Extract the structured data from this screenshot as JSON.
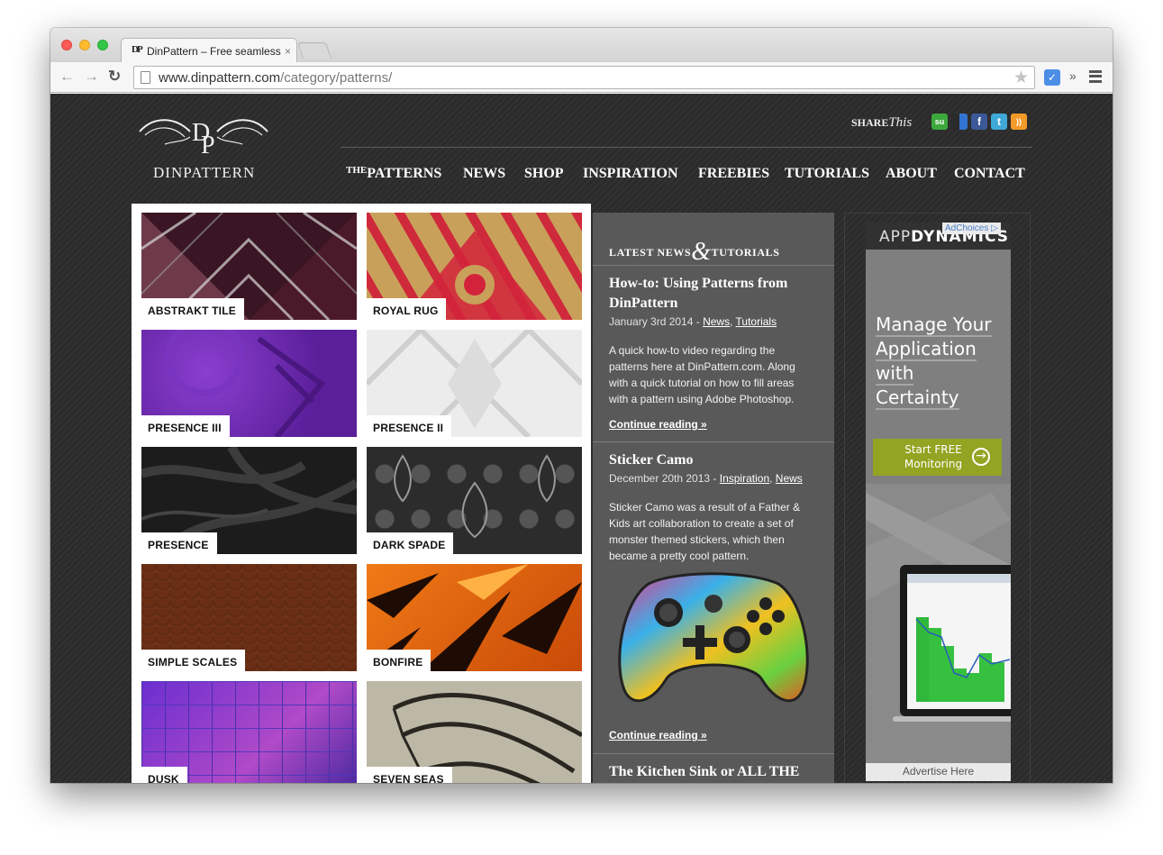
{
  "browser": {
    "tab_title": "DinPattern – Free seamless",
    "tab_favicon": "DP",
    "tab_close": "×",
    "url_domain": "www.dinpattern.com",
    "url_path": "/category/patterns/",
    "back_glyph": "←",
    "forward_glyph": "→",
    "reload_glyph": "↻",
    "star_glyph": "★",
    "ext_glyph": "✓",
    "overflow_glyph": "»"
  },
  "site": {
    "logo_text": "DINPATTERN",
    "logo_mark": "DP",
    "share_prefix": "SHARE",
    "share_script": "This",
    "social": [
      {
        "icon": "stumbleupon-icon",
        "glyph": "su",
        "color": "#3ca83c"
      },
      {
        "icon": "delicious-icon",
        "glyph": "",
        "color": "#ffffff"
      },
      {
        "icon": "facebook-icon",
        "glyph": "f",
        "color": "#3b5998"
      },
      {
        "icon": "twitter-icon",
        "glyph": "t",
        "color": "#3fa9d8"
      },
      {
        "icon": "rss-icon",
        "glyph": "))",
        "color": "#f39a29"
      }
    ],
    "nav": {
      "patterns_prefix": "THE",
      "patterns": "PATTERNS",
      "news": "NEWS",
      "shop": "SHOP",
      "inspiration": "INSPIRATION",
      "freebies": "FREEBIES",
      "tutorials": "TUTORIALS",
      "about": "ABOUT",
      "contact": "CONTACT"
    }
  },
  "patterns": [
    {
      "label": "ABSTRAKT TILE"
    },
    {
      "label": "ROYAL RUG"
    },
    {
      "label": "PRESENCE III"
    },
    {
      "label": "PRESENCE II"
    },
    {
      "label": "PRESENCE"
    },
    {
      "label": "DARK SPADE"
    },
    {
      "label": "SIMPLE SCALES"
    },
    {
      "label": "BONFIRE"
    },
    {
      "label": "DUSK"
    },
    {
      "label": "SEVEN SEAS"
    }
  ],
  "news": {
    "heading_left": "LATEST NEWS",
    "heading_amp": "&",
    "heading_right": "TUTORIALS",
    "posts": [
      {
        "title": "How-to: Using Patterns from DinPattern",
        "date": "January 3rd 2014 - ",
        "cat1": "News",
        "sep": ", ",
        "cat2": "Tutorials",
        "body": "A quick how-to video regarding the patterns here at DinPattern.com. Along with a quick tutorial on how to fill areas with a pattern using Adobe Photoshop.",
        "more": "Continue reading »"
      },
      {
        "title": "Sticker Camo",
        "date": "December 20th 2013 - ",
        "cat1": "Inspiration",
        "sep": ", ",
        "cat2": "News",
        "body": "Sticker Camo was a result of a Father & Kids art collaboration to create a set of monster themed stickers, which then became a pretty cool pattern.",
        "more": "Continue reading »"
      },
      {
        "title": "The Kitchen Sink or ALL THE"
      }
    ]
  },
  "ad": {
    "brand_light": "APP",
    "brand_bold": "DYNAMICS",
    "adchoices": "AdChoices ▷",
    "headline": [
      "Manage Your",
      "Application",
      "with",
      "Certainty"
    ],
    "cta": "Start FREE Monitoring",
    "cta_glyph": "→",
    "footer": "Advertise Here"
  }
}
